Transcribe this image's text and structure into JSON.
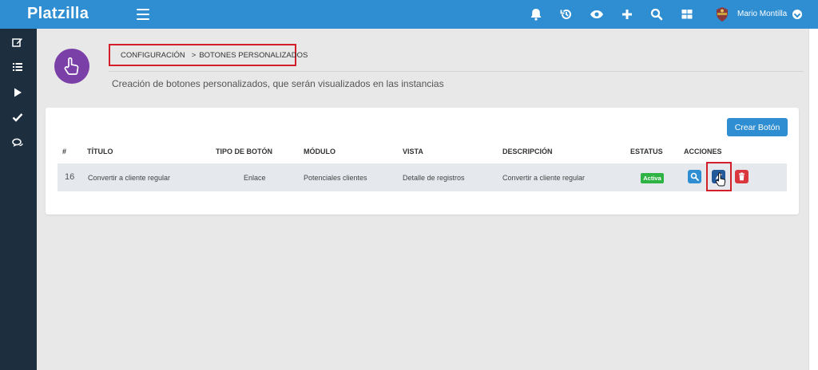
{
  "app": {
    "name": "Platzilla"
  },
  "topbar": {
    "icons": [
      "menu-icon",
      "bell-icon",
      "history-icon",
      "eye-icon",
      "plus-icon",
      "search-icon",
      "grid-icon"
    ],
    "user_name": "Mario Montilla"
  },
  "sidebar": {
    "icons": [
      "edit-icon",
      "list-icon",
      "play-icon",
      "check-icon",
      "chat-icon"
    ]
  },
  "page": {
    "breadcrumb": [
      "CONFIGURACIÓN",
      "BOTONES PERSONALIZADOS"
    ],
    "breadcrumb_separator": ">",
    "subtitle": "Creación de botones personalizados, que serán visualizados en las instancias"
  },
  "toolbar": {
    "create_label": "Crear Botón"
  },
  "table": {
    "headers": [
      "#",
      "TÍTULO",
      "TIPO DE BOTÓN",
      "MÓDULO",
      "VISTA",
      "DESCRIPCIÓN",
      "ESTATUS",
      "ACCIONES"
    ],
    "rows": [
      {
        "id": "16",
        "titulo": "Convertir a cliente regular",
        "tipo": "Enlace",
        "modulo": "Potenciales clientes",
        "vista": "Detalle de registros",
        "descripcion": "Convertir a cliente regular",
        "estatus": "Activa"
      }
    ],
    "actions": [
      "search-icon",
      "edit-icon",
      "trash-icon"
    ]
  },
  "colors": {
    "topbar": "#2f8ed1",
    "sidebar": "#1d2e3f",
    "accent_purple": "#7b3fa8",
    "status_active": "#2fb344",
    "danger": "#d9363e",
    "highlight": "#d21f2a"
  }
}
